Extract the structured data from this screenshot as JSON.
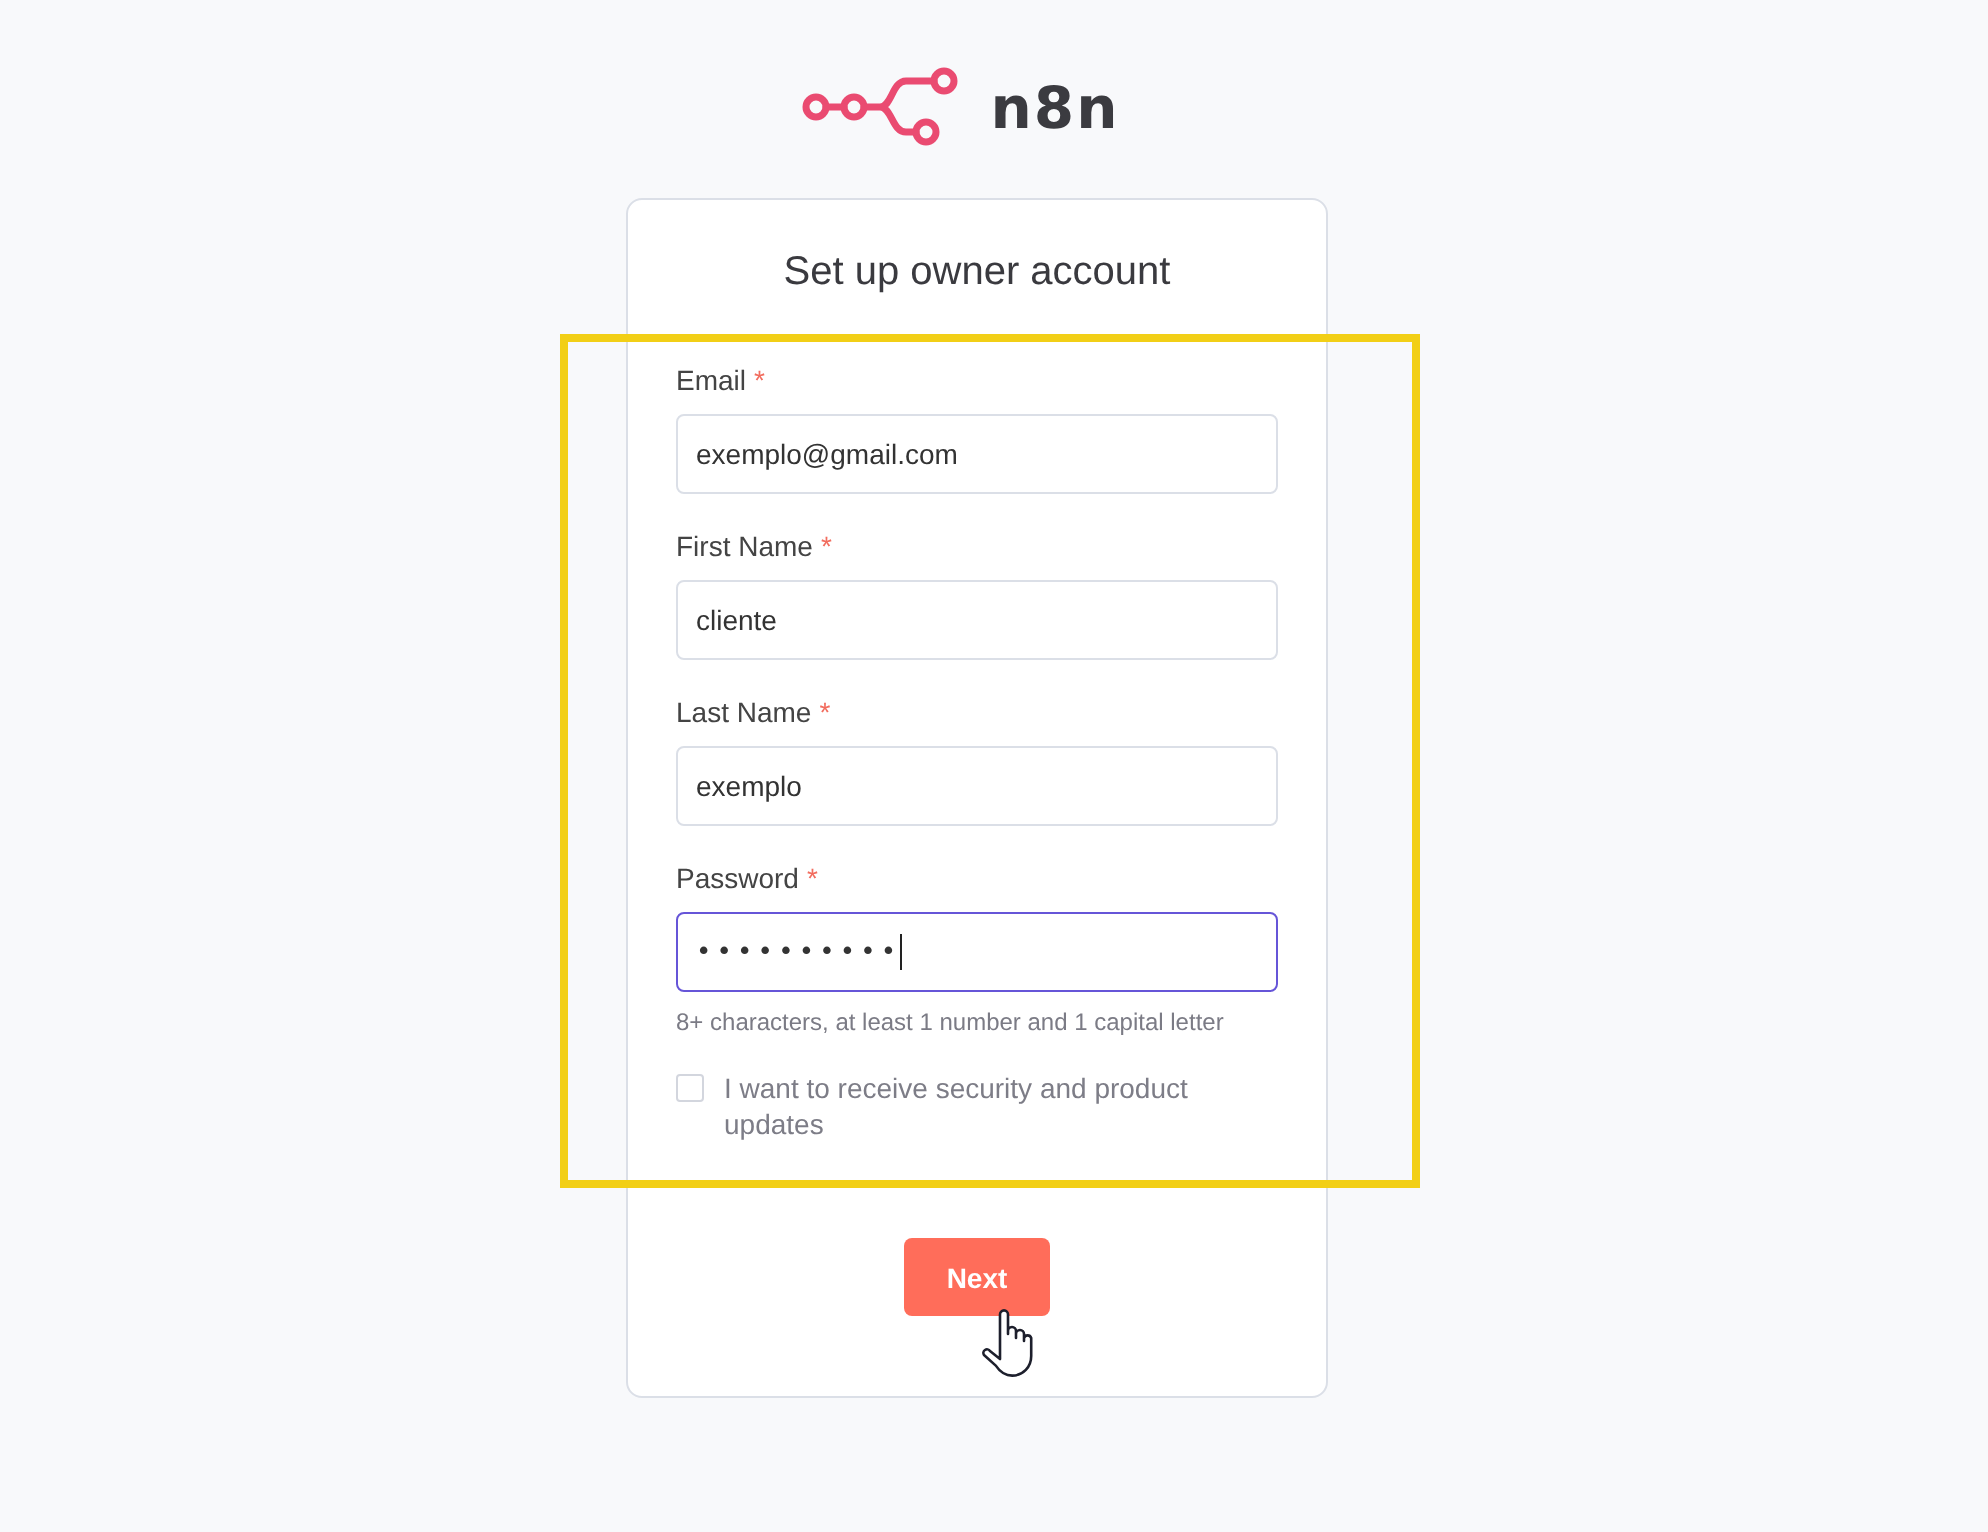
{
  "logo": {
    "wordmark": "n8n"
  },
  "card": {
    "title": "Set up owner account",
    "fields": [
      {
        "label": "Email",
        "required_mark": "*",
        "value": "exemplo@gmail.com",
        "focused": false
      },
      {
        "label": "First Name",
        "required_mark": "*",
        "value": "cliente",
        "focused": false
      },
      {
        "label": "Last Name",
        "required_mark": "*",
        "value": "exemplo",
        "focused": false
      },
      {
        "label": "Password",
        "required_mark": "*",
        "value": "••••••••••",
        "focused": true,
        "hint": "8+ characters, at least 1 number and 1 capital letter"
      }
    ],
    "checkbox": {
      "label": "I want to receive security and product updates",
      "checked": false
    },
    "button": {
      "label": "Next"
    }
  }
}
